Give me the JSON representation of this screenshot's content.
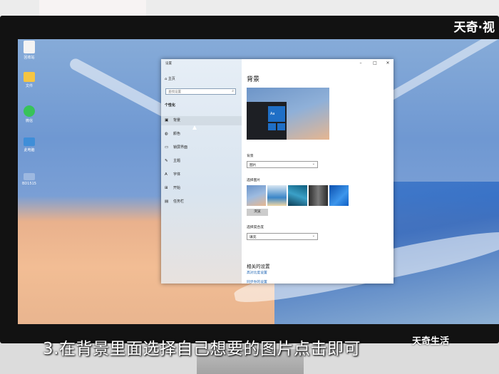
{
  "watermark": "天奇·视",
  "logo": "天奇生活",
  "subtitle": "3.在背景里面选择自己想要的图片点击即可",
  "desktop": {
    "icons": [
      {
        "name": "recycle-bin",
        "label": "回收站"
      },
      {
        "name": "folder",
        "label": "文件"
      },
      {
        "name": "wechat",
        "label": "微信"
      },
      {
        "name": "this-pc",
        "label": "此电脑"
      },
      {
        "name": "screenshot-file",
        "label": "BD1515"
      }
    ]
  },
  "window": {
    "title": "设置",
    "controls": {
      "minimize": "–",
      "maximize": "□",
      "close": "✕"
    },
    "nav": {
      "home": "主页",
      "search_placeholder": "查找设置",
      "section": "个性化",
      "items": [
        {
          "label": "背景",
          "icon": "image-icon"
        },
        {
          "label": "颜色",
          "icon": "palette-icon"
        },
        {
          "label": "锁屏界面",
          "icon": "lock-screen-icon"
        },
        {
          "label": "主题",
          "icon": "theme-icon"
        },
        {
          "label": "字体",
          "icon": "font-icon"
        },
        {
          "label": "开始",
          "icon": "start-icon"
        },
        {
          "label": "任务栏",
          "icon": "taskbar-icon"
        }
      ],
      "active_index": 0
    },
    "content": {
      "heading": "背景",
      "preview_text": "Aa",
      "background_label": "背景",
      "background_value": "图片",
      "choose_picture_label": "选择图片",
      "browse_label": "浏览",
      "fit_label": "选择契合度",
      "fit_value": "填充",
      "related_heading": "相关的设置",
      "related_links": [
        "高对比度设置",
        "同步你的设置"
      ]
    }
  },
  "colors": {
    "accent": "#1f6fc6",
    "link": "#1d64b3"
  }
}
